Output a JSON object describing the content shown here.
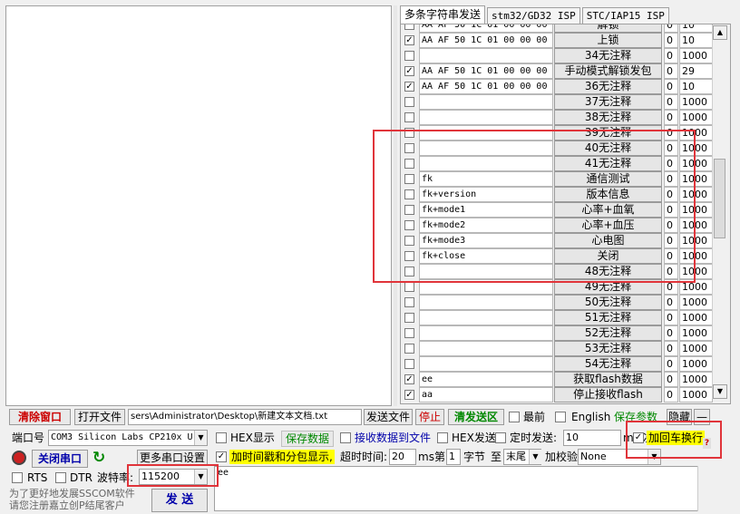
{
  "tabs": [
    {
      "label": "多条字符串发送",
      "active": true
    },
    {
      "label": "stm32/GD32 ISP",
      "active": false
    },
    {
      "label": "STC/IAP15 ISP",
      "active": false
    }
  ],
  "rows": [
    {
      "checked": false,
      "hex": "AA AF 50 1C 01 00 00 00",
      "label": "解锁",
      "order": "0",
      "delay": "10"
    },
    {
      "checked": true,
      "hex": "AA AF 50 1C 01 00 00 00",
      "label": "上锁",
      "order": "0",
      "delay": "10"
    },
    {
      "checked": false,
      "hex": "",
      "label": "34无注释",
      "order": "0",
      "delay": "1000"
    },
    {
      "checked": true,
      "hex": "AA AF 50 1C 01 00 00 00",
      "label": "手动模式解锁发包",
      "order": "0",
      "delay": "29"
    },
    {
      "checked": true,
      "hex": "AA AF 50 1C 01 00 00 00",
      "label": "36无注释",
      "order": "0",
      "delay": "10"
    },
    {
      "checked": false,
      "hex": "",
      "label": "37无注释",
      "order": "0",
      "delay": "1000"
    },
    {
      "checked": false,
      "hex": "",
      "label": "38无注释",
      "order": "0",
      "delay": "1000"
    },
    {
      "checked": false,
      "hex": "",
      "label": "39无注释",
      "order": "0",
      "delay": "1000"
    },
    {
      "checked": false,
      "hex": "",
      "label": "40无注释",
      "order": "0",
      "delay": "1000"
    },
    {
      "checked": false,
      "hex": "",
      "label": "41无注释",
      "order": "0",
      "delay": "1000"
    },
    {
      "checked": false,
      "hex": "fk",
      "label": "通信测试",
      "order": "0",
      "delay": "1000"
    },
    {
      "checked": false,
      "hex": "fk+version",
      "label": "版本信息",
      "order": "0",
      "delay": "1000"
    },
    {
      "checked": false,
      "hex": "fk+mode1",
      "label": "心率+血氧",
      "order": "0",
      "delay": "1000"
    },
    {
      "checked": false,
      "hex": "fk+mode2",
      "label": "心率+血压",
      "order": "0",
      "delay": "1000"
    },
    {
      "checked": false,
      "hex": "fk+mode3",
      "label": "心电图",
      "order": "0",
      "delay": "1000"
    },
    {
      "checked": false,
      "hex": "fk+close",
      "label": "关闭",
      "order": "0",
      "delay": "1000"
    },
    {
      "checked": false,
      "hex": "",
      "label": "48无注释",
      "order": "0",
      "delay": "1000"
    },
    {
      "checked": false,
      "hex": "",
      "label": "49无注释",
      "order": "0",
      "delay": "1000"
    },
    {
      "checked": false,
      "hex": "",
      "label": "50无注释",
      "order": "0",
      "delay": "1000"
    },
    {
      "checked": false,
      "hex": "",
      "label": "51无注释",
      "order": "0",
      "delay": "1000"
    },
    {
      "checked": false,
      "hex": "",
      "label": "52无注释",
      "order": "0",
      "delay": "1000"
    },
    {
      "checked": false,
      "hex": "",
      "label": "53无注释",
      "order": "0",
      "delay": "1000"
    },
    {
      "checked": false,
      "hex": "",
      "label": "54无注释",
      "order": "0",
      "delay": "1000"
    },
    {
      "checked": true,
      "hex": "ee",
      "label": "获取flash数据",
      "order": "0",
      "delay": "1000"
    },
    {
      "checked": true,
      "hex": "aa",
      "label": "停止接收flash",
      "order": "0",
      "delay": "1000"
    }
  ],
  "toolbar": {
    "clear_window": "清除窗口",
    "open_file": "打开文件",
    "file_path": "sers\\Administrator\\Desktop\\新建文本文档.txt",
    "send_file": "发送文件",
    "stop": "停止",
    "clear_send": "清发送区",
    "topmost": "最前",
    "english": "English",
    "save_params": "保存参数",
    "expand": "隐藏",
    "minus": "—"
  },
  "port": {
    "label": "端口号",
    "value": "COM3 Silicon Labs CP210x U..",
    "close_port": "关闭串口",
    "more_settings": "更多串口设置",
    "rts": "RTS",
    "dtr": "DTR",
    "baud_label": "波特率:",
    "baud": "115200"
  },
  "options": {
    "hex_display": "HEX显示",
    "save_data": "保存数据",
    "recv_to_file": "接收数据到文件",
    "hex_send": "HEX发送",
    "timed_send": "定时发送:",
    "interval": "10",
    "interval_unit": "ms/次",
    "add_crlf": "加回车换行",
    "add_timestamp": "加时间戳和分包显示,",
    "timeout_label": "超时时间:",
    "timeout": "20",
    "timeout_unit": "ms",
    "byte_prefix": "第",
    "byte_from": "1",
    "byte_label": "字节",
    "to_label": "至",
    "to_value": "末尾",
    "checksum_label": "加校验",
    "checksum": "None",
    "help": "?"
  },
  "send": {
    "text": "ee",
    "button": "发 送"
  },
  "promo": {
    "line1": "为了更好地发展SSCOM软件",
    "line2": "请您注册嘉立创P结尾客户"
  },
  "colors": {
    "accent_red": "#cc0000",
    "accent_blue": "#0000aa",
    "accent_green": "#008800",
    "highlight_yellow": "#ffff00",
    "annotation_red": "#e0343a"
  }
}
